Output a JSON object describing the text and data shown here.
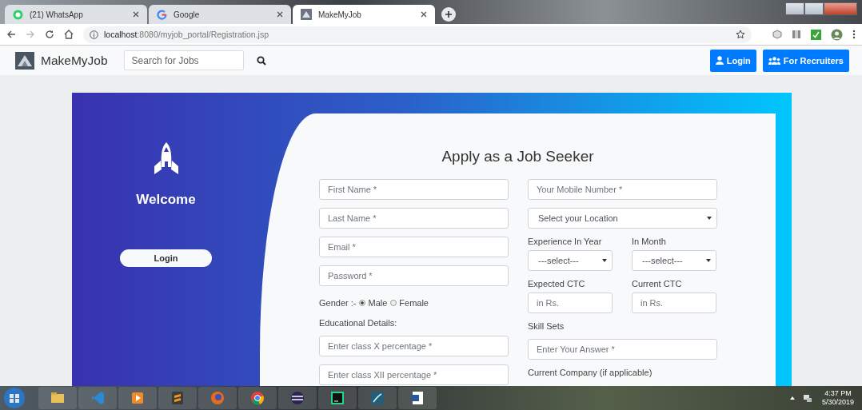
{
  "browser": {
    "tabs": [
      {
        "title": "(21) WhatsApp",
        "selected": false
      },
      {
        "title": "Google",
        "selected": false
      },
      {
        "title": "MakeMyJob",
        "selected": true
      }
    ],
    "url_host": "localhost",
    "url_path": ":8080/myjob_portal/Registration.jsp"
  },
  "navbar": {
    "brand": "MakeMyJob",
    "search_placeholder": "Search for Jobs",
    "buttons": [
      "Login",
      "For Recruiters"
    ]
  },
  "welcome": {
    "title": "Welcome",
    "button": "Login"
  },
  "form": {
    "title": "Apply as a Job Seeker",
    "left": [
      {
        "kind": "input",
        "placeholder": "First Name *"
      },
      {
        "kind": "input",
        "placeholder": "Last Name *"
      },
      {
        "kind": "input",
        "placeholder": "Email *"
      },
      {
        "kind": "input",
        "placeholder": "Password *"
      },
      {
        "kind": "radio",
        "label": "Gender :-",
        "options": [
          {
            "label": "Male",
            "selected": true
          },
          {
            "label": "Female",
            "selected": false
          }
        ]
      },
      {
        "kind": "label",
        "text": "Educational Details:"
      },
      {
        "kind": "input",
        "placeholder": "Enter class X percentage *"
      },
      {
        "kind": "input",
        "placeholder": "Enter class XII percentage *"
      }
    ],
    "right": [
      {
        "kind": "input",
        "placeholder": "Your Mobile Number *"
      },
      {
        "kind": "select",
        "value": "Select your Location"
      },
      {
        "kind": "pair",
        "items": [
          {
            "label": "Experience In Year",
            "kind": "select",
            "value": "---select---"
          },
          {
            "label": "In Month",
            "kind": "select",
            "value": "---select---"
          }
        ]
      },
      {
        "kind": "pair",
        "items": [
          {
            "label": "Expected CTC",
            "kind": "input",
            "placeholder": "in Rs."
          },
          {
            "label": "Current CTC",
            "kind": "input",
            "placeholder": "in Rs."
          }
        ]
      },
      {
        "kind": "label",
        "text": "Skill Sets"
      },
      {
        "kind": "input",
        "placeholder": "Enter Your Answer *"
      },
      {
        "kind": "label",
        "text": "Current Company (if applicable)"
      }
    ]
  },
  "taskbar": {
    "time": "4:37 PM",
    "date": "5/30/2019"
  }
}
